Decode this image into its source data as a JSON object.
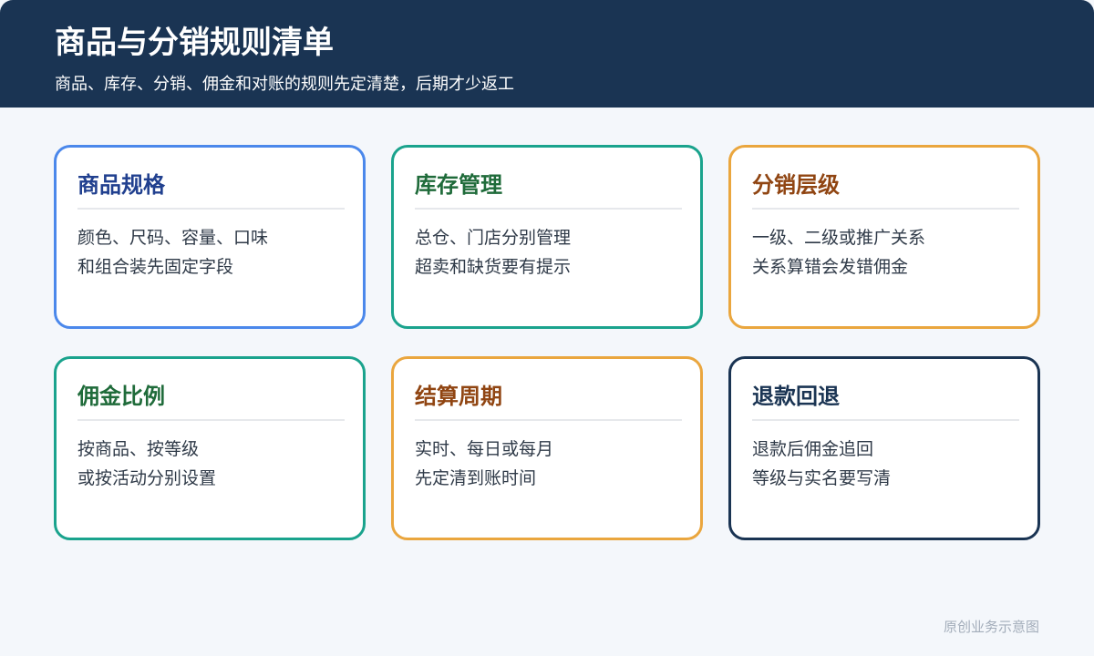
{
  "header": {
    "title": "商品与分销规则清单",
    "subtitle": "商品、库存、分销、佣金和对账的规则先定清楚，后期才少返工"
  },
  "cards": [
    {
      "title": "商品规格",
      "lines": [
        "颜色、尺码、容量、口味",
        "和组合装先固定字段"
      ],
      "border_color": "#4b88eb",
      "title_color": "#21408f"
    },
    {
      "title": "库存管理",
      "lines": [
        "总仓、门店分别管理",
        "超卖和缺货要有提示"
      ],
      "border_color": "#1aa38d",
      "title_color": "#1f6b3a"
    },
    {
      "title": "分销层级",
      "lines": [
        "一级、二级或推广关系",
        "关系算错会发错佣金"
      ],
      "border_color": "#eaa63e",
      "title_color": "#904512"
    },
    {
      "title": "佣金比例",
      "lines": [
        "按商品、按等级",
        "或按活动分别设置"
      ],
      "border_color": "#1aa38d",
      "title_color": "#1f6b3a"
    },
    {
      "title": "结算周期",
      "lines": [
        "实时、每日或每月",
        "先定清到账时间"
      ],
      "border_color": "#eaa63e",
      "title_color": "#904512"
    },
    {
      "title": "退款回退",
      "lines": [
        "退款后佣金追回",
        "等级与实名要写清"
      ],
      "border_color": "#1a3453",
      "title_color": "#1a3453"
    }
  ],
  "footer": {
    "note": "原创业务示意图"
  }
}
